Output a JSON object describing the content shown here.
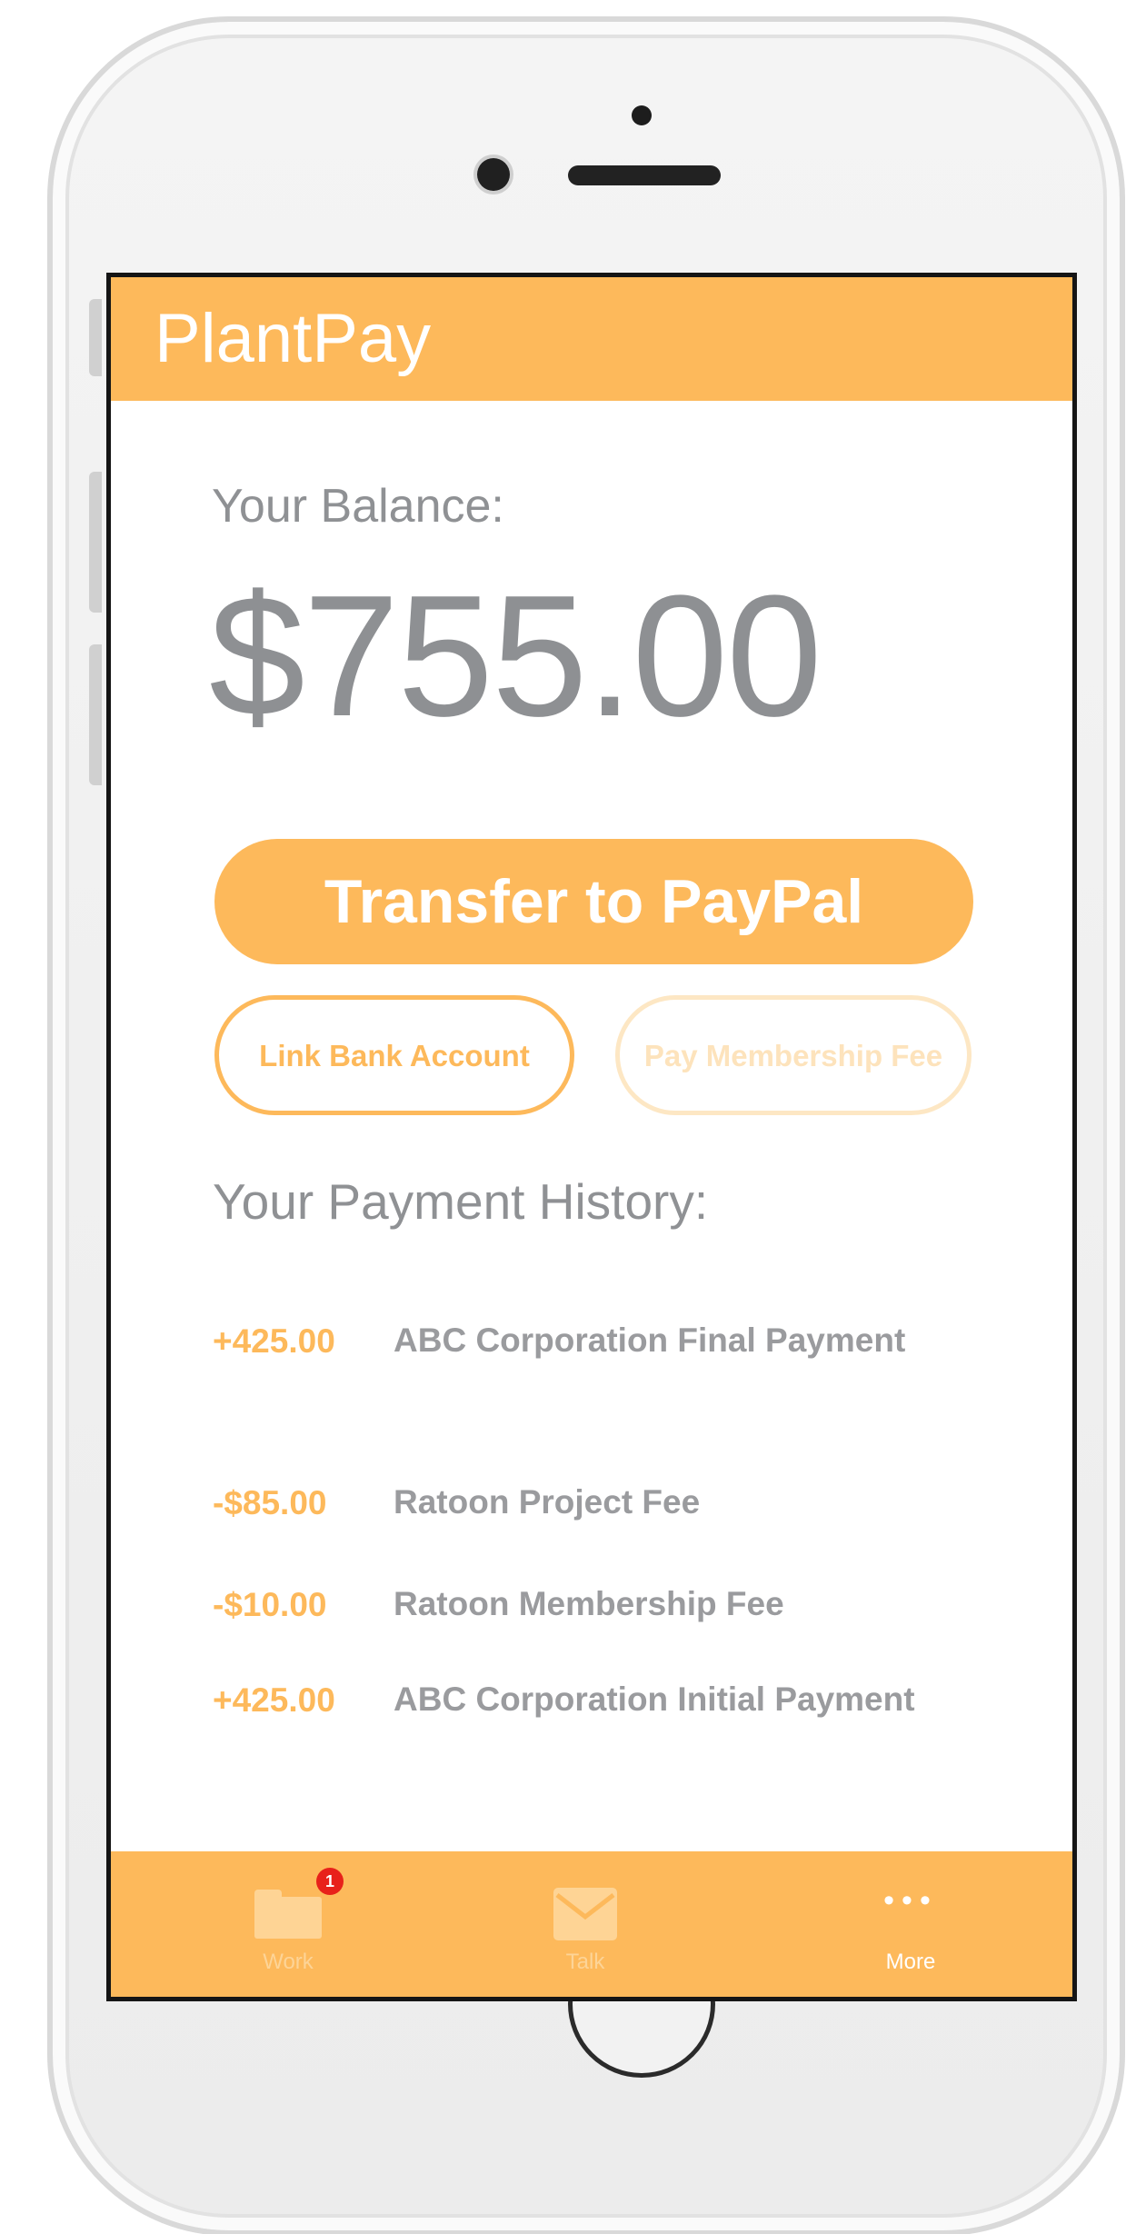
{
  "app": {
    "title": "PlantPay"
  },
  "balance": {
    "label": "Your Balance:",
    "amount": "$755.00"
  },
  "actions": {
    "transfer_label": "Transfer to PayPal",
    "link_bank_label": "Link Bank Account",
    "pay_fee_label": "Pay Membership Fee"
  },
  "history": {
    "label": "Your Payment History:",
    "items": [
      {
        "amount": "+425.00",
        "description": "ABC Corporation Final Payment"
      },
      {
        "amount": "-$85.00",
        "description": "Ratoon Project Fee"
      },
      {
        "amount": "-$10.00",
        "description": "Ratoon Membership Fee"
      },
      {
        "amount": "+425.00",
        "description": "ABC Corporation Initial Payment"
      }
    ]
  },
  "tabbar": {
    "work": {
      "label": "Work",
      "icon": "folder-icon",
      "badge": "1"
    },
    "talk": {
      "label": "Talk",
      "icon": "mail-icon"
    },
    "more": {
      "label": "More",
      "icon": "more-dots-icon"
    }
  },
  "colors": {
    "accent": "#fdb95b",
    "text_gray": "#8f9194",
    "badge_red": "#e8211a"
  }
}
